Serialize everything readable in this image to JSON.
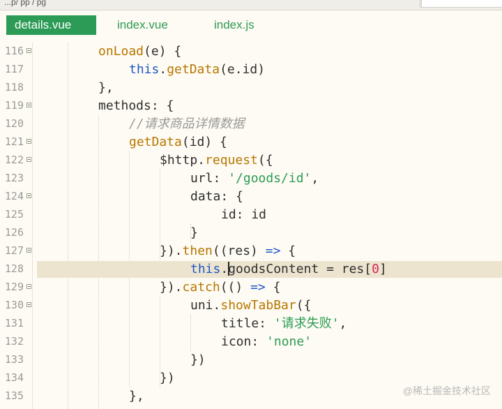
{
  "topbar": {
    "breadcrumb": "...p/ pp / pg"
  },
  "tabs": [
    {
      "label": "details.vue",
      "active": true
    },
    {
      "label": "index.vue",
      "active": false
    },
    {
      "label": "index.js",
      "active": false
    }
  ],
  "colors": {
    "keyword": "#1f57c6",
    "function": "#b77600",
    "string": "#2c9b55",
    "comment": "#9a9a9a",
    "number": "#d9245a",
    "active_tab": "#2c9b55",
    "highlight": "#ece4cf"
  },
  "editor": {
    "lines": [
      {
        "num": "116",
        "fold": true,
        "tokens": [
          "",
          "onLoad",
          "(e) {"
        ]
      },
      {
        "num": "117",
        "fold": false,
        "tokens": [
          "this",
          ".",
          "getData",
          "(e.id)"
        ]
      },
      {
        "num": "118",
        "fold": false,
        "tokens": [
          "},"
        ]
      },
      {
        "num": "119",
        "fold": true,
        "tokens": [
          "methods: {"
        ]
      },
      {
        "num": "120",
        "fold": false,
        "tokens": [
          "//请求商品详情数据"
        ]
      },
      {
        "num": "121",
        "fold": true,
        "tokens": [
          "getData",
          "(id) {"
        ]
      },
      {
        "num": "122",
        "fold": true,
        "tokens": [
          "$http.",
          "request",
          "({"
        ]
      },
      {
        "num": "123",
        "fold": false,
        "tokens": [
          "url: ",
          "'/goods/id'",
          ","
        ]
      },
      {
        "num": "124",
        "fold": true,
        "tokens": [
          "data: {"
        ]
      },
      {
        "num": "125",
        "fold": false,
        "tokens": [
          "id: id"
        ]
      },
      {
        "num": "126",
        "fold": false,
        "tokens": [
          "}"
        ]
      },
      {
        "num": "127",
        "fold": true,
        "tokens": [
          "}).",
          "then",
          "((res) ",
          "=>",
          " {"
        ]
      },
      {
        "num": "128",
        "fold": false,
        "tokens": [
          "this",
          ".",
          "goodsContent = res[",
          "0",
          "]"
        ]
      },
      {
        "num": "129",
        "fold": true,
        "tokens": [
          "}).",
          "catch",
          "(() ",
          "=>",
          " {"
        ]
      },
      {
        "num": "130",
        "fold": true,
        "tokens": [
          "uni.",
          "showTabBar",
          "({"
        ]
      },
      {
        "num": "131",
        "fold": false,
        "tokens": [
          "title: ",
          "'请求失败'",
          ","
        ]
      },
      {
        "num": "132",
        "fold": false,
        "tokens": [
          "icon: ",
          "'none'"
        ]
      },
      {
        "num": "133",
        "fold": false,
        "tokens": [
          "})"
        ]
      },
      {
        "num": "134",
        "fold": false,
        "tokens": [
          "})"
        ]
      },
      {
        "num": "135",
        "fold": false,
        "tokens": [
          "},"
        ]
      }
    ]
  },
  "watermark": "@稀土掘金技术社区"
}
